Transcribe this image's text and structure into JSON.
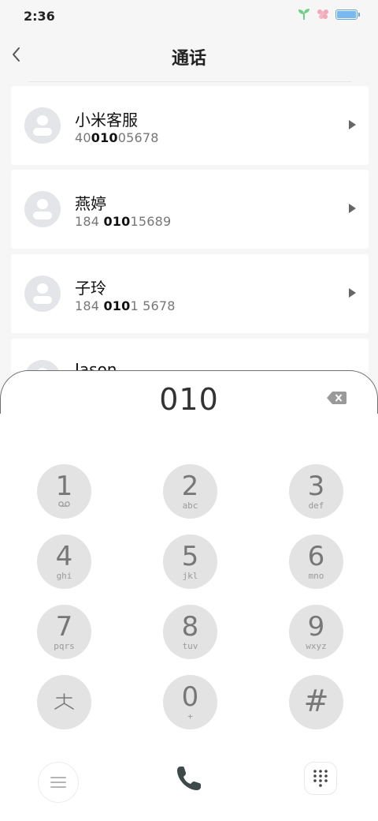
{
  "status_bar": {
    "time": "2:36",
    "battery_level": 1.0
  },
  "header": {
    "title": "通话"
  },
  "contacts": [
    {
      "name": "小米客服",
      "number_parts": [
        "40",
        "010",
        "05678"
      ]
    },
    {
      "name": "燕婷",
      "number_parts": [
        "184 ",
        "010",
        "15689"
      ]
    },
    {
      "name": "子玲",
      "number_parts": [
        "184 ",
        "010",
        "1 5678"
      ]
    },
    {
      "name": "Jason",
      "number_parts": [
        "",
        "",
        ""
      ]
    }
  ],
  "dialer": {
    "input_value": "010",
    "keys": [
      {
        "digit": "1",
        "sub": ""
      },
      {
        "digit": "2",
        "sub": "abc"
      },
      {
        "digit": "3",
        "sub": "def"
      },
      {
        "digit": "4",
        "sub": "ghi"
      },
      {
        "digit": "5",
        "sub": "jkl"
      },
      {
        "digit": "6",
        "sub": "mno"
      },
      {
        "digit": "7",
        "sub": "pqrs"
      },
      {
        "digit": "8",
        "sub": "tuv"
      },
      {
        "digit": "9",
        "sub": "wxyz"
      },
      {
        "digit": "*",
        "sub": ""
      },
      {
        "digit": "0",
        "sub": "+"
      },
      {
        "digit": "#",
        "sub": ""
      }
    ]
  },
  "icons": {
    "back": "chevron-left-icon",
    "backspace": "backspace-icon",
    "voicemail": "voicemail-icon",
    "menu": "menu-icon",
    "call": "phone-icon",
    "keypad": "dialpad-icon"
  },
  "colors": {
    "accent_call": "#3e4a4a",
    "key_bg": "#e3e3e3",
    "battery": "#7ab8f0",
    "status_sprout": "#6ccf8a",
    "status_flower": "#f2a9b9"
  }
}
